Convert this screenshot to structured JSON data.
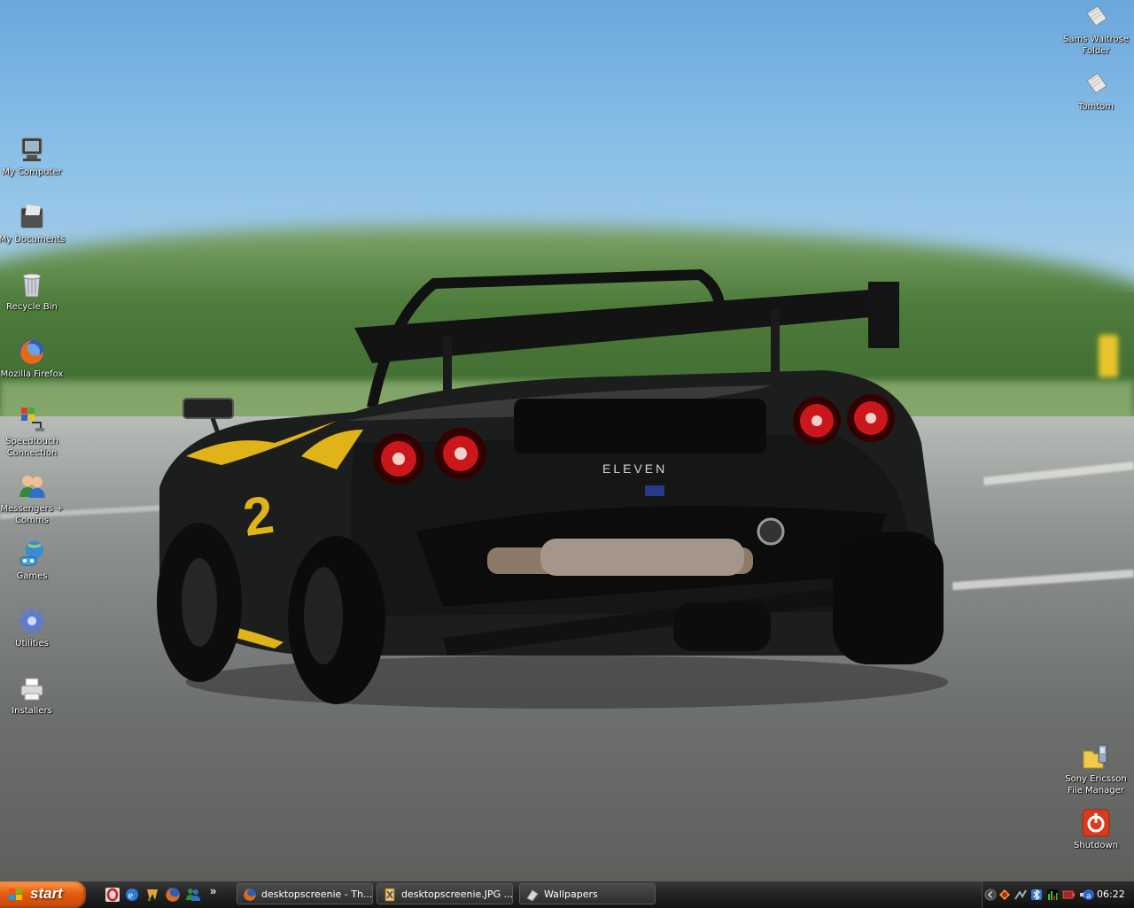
{
  "desktop": {
    "left_icons": [
      {
        "label": "My Computer",
        "icon": "computer-icon"
      },
      {
        "label": "My Documents",
        "icon": "documents-folder-icon"
      },
      {
        "label": "Recycle Bin",
        "icon": "recycle-bin-icon"
      },
      {
        "label": "Mozilla Firefox",
        "icon": "firefox-icon"
      },
      {
        "label_lines": [
          "Speedtouch",
          "Connection"
        ],
        "icon": "network-connection-icon"
      },
      {
        "label_lines": [
          "Messengers +",
          "Comms"
        ],
        "icon": "messengers-icon"
      },
      {
        "label": "Games",
        "icon": "games-icon"
      },
      {
        "label": "Utilities",
        "icon": "gear-icon"
      },
      {
        "label": "Installers",
        "icon": "printer-icon"
      }
    ],
    "right_icons": [
      {
        "label_lines": [
          "Sams Waitrose",
          "Folder"
        ],
        "icon": "shortcut-file-icon"
      },
      {
        "label": "Tomtom",
        "icon": "shortcut-file-icon"
      },
      {
        "label_lines": [
          "Sony Ericsson",
          "File Manager"
        ],
        "icon": "phone-folder-icon"
      },
      {
        "label": "Shutdown",
        "icon": "power-icon"
      }
    ],
    "wallpaper": {
      "subject": "black and yellow race car",
      "badge": "ELEVEN",
      "number": "2"
    }
  },
  "taskbar": {
    "start_label": "start",
    "quick_launch": [
      "opera-icon",
      "ie-icon",
      "winamp-icon",
      "firefox-icon",
      "messenger-icon"
    ],
    "overflow": "»",
    "tasks": [
      {
        "label": "desktopscreenie - Th...",
        "icon": "firefox-icon"
      },
      {
        "label": "desktopscreenie.JPG ...",
        "icon": "image-editor-icon"
      },
      {
        "label": "Wallpapers",
        "icon": "folder-icon"
      }
    ],
    "tray": {
      "icons": [
        "chevron-left-icon",
        "antivirus-icon",
        "network-icon",
        "bluetooth-icon",
        "cpu-meter-icon",
        "battery-icon",
        "volume-icon",
        "update-icon"
      ],
      "clock": "06:22"
    }
  },
  "colors": {
    "start_orange": "#e45d10",
    "taskbar_dark": "#1e1e1e"
  }
}
